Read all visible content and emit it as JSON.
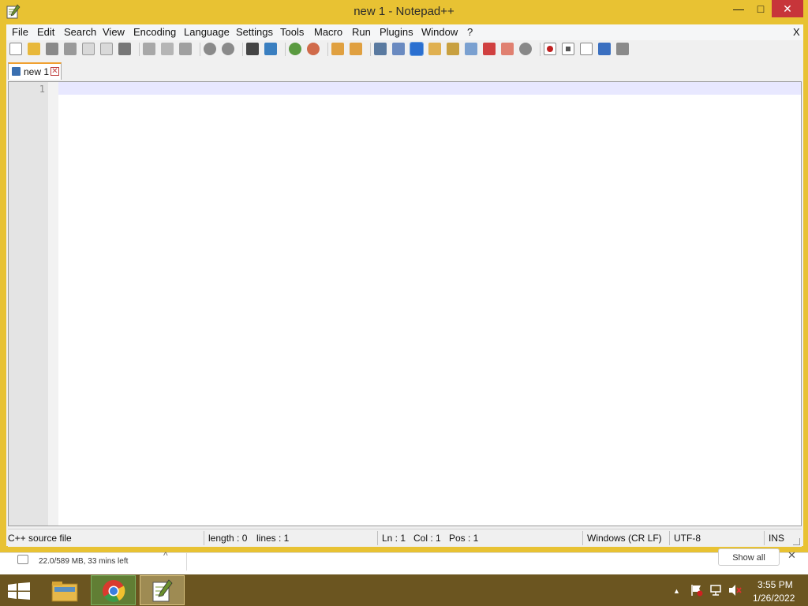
{
  "window": {
    "title": "new 1 - Notepad++",
    "min_symbol": "—",
    "max_symbol": "□",
    "close_symbol": "✕"
  },
  "menu": {
    "items": [
      "File",
      "Edit",
      "Search",
      "View",
      "Encoding",
      "Language",
      "Settings",
      "Tools",
      "Macro",
      "Run",
      "Plugins",
      "Window",
      "?"
    ],
    "close_symbol": "X"
  },
  "toolbar": {
    "icons": [
      "new-file-icon",
      "open-file-icon",
      "save-icon",
      "save-all-icon",
      "close-icon",
      "close-all-icon",
      "print-icon",
      "cut-icon",
      "copy-icon",
      "paste-icon",
      "undo-icon",
      "redo-icon",
      "find-icon",
      "replace-icon",
      "zoom-in-icon",
      "zoom-out-icon",
      "sync-vertical-icon",
      "sync-horizontal-icon",
      "word-wrap-icon",
      "show-all-characters-icon",
      "indent-guide-icon",
      "user-defined-language-icon",
      "document-map-icon",
      "function-list-icon",
      "folder-as-workspace-icon",
      "monitoring-icon",
      "record-macro-icon",
      "stop-recording-icon",
      "playback-macro-icon",
      "run-macro-multiple-icon",
      "save-macro-icon"
    ]
  },
  "tabs": [
    {
      "label": "new 1",
      "close_symbol": "✕"
    }
  ],
  "editor": {
    "line_numbers": [
      "1"
    ]
  },
  "status": {
    "language": "C++ source file",
    "length": "length : 0",
    "lines": "lines : 1",
    "ln": "Ln : 1",
    "col": "Col : 1",
    "pos": "Pos : 1",
    "eol": "Windows (CR LF)",
    "encoding": "UTF-8",
    "mode": "INS"
  },
  "download": {
    "text": "22.0/589 MB, 33 mins left",
    "show_all": "Show all",
    "caret": "^",
    "close_symbol": "✕"
  },
  "taskbar": {
    "time": "3:55 PM",
    "date": "1/26/2022",
    "tray_up_arrow": "▲"
  }
}
